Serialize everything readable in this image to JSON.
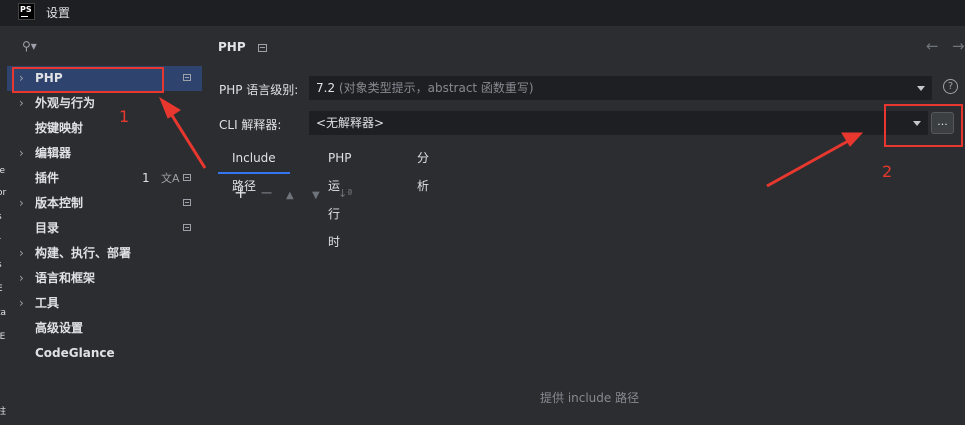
{
  "window": {
    "app_logo": "PS",
    "title": "设置"
  },
  "left_strip_letters": [
    "le",
    "or",
    "s",
    "r",
    "s",
    "E",
    "ta",
    "IE",
    "拄"
  ],
  "sidebar": {
    "search": {
      "placeholder": ""
    },
    "items": [
      {
        "label": "PHP",
        "chevron": true,
        "icon": "settings-scope-icon",
        "selected": true
      },
      {
        "label": "外观与行为",
        "chevron": true
      },
      {
        "label": "按键映射",
        "chevron": false
      },
      {
        "label": "编辑器",
        "chevron": true
      },
      {
        "label": "插件",
        "chevron": false,
        "count": "1",
        "icon": "translate-icon"
      },
      {
        "label": "版本控制",
        "chevron": true,
        "icon": "settings-scope-icon"
      },
      {
        "label": "目录",
        "chevron": false,
        "icon": "settings-scope-icon"
      },
      {
        "label": "构建、执行、部署",
        "chevron": true
      },
      {
        "label": "语言和框架",
        "chevron": true
      },
      {
        "label": "工具",
        "chevron": true
      },
      {
        "label": "高级设置",
        "chevron": false
      },
      {
        "label": "CodeGlance",
        "chevron": false
      }
    ]
  },
  "main": {
    "title": "PHP",
    "php_level": {
      "label": "PHP 语言级别:",
      "value": "7.2",
      "hint": "(对象类型提示，abstract 函数重写)"
    },
    "cli": {
      "label": "CLI 解释器:",
      "value": "<无解释器>",
      "more_label": "..."
    },
    "tabs": [
      {
        "label": "Include 路径",
        "active": true
      },
      {
        "label": "PHP 运行时",
        "active": false
      },
      {
        "label": "分析",
        "active": false
      }
    ],
    "toolbar": {
      "add": "+",
      "remove": "−",
      "up": "▲",
      "down": "▼",
      "sort": "↓ª"
    },
    "empty_text": "提供 include 路径"
  },
  "annotations": {
    "label_1": "1",
    "label_2": "2",
    "color": "#e8372e"
  },
  "colors": {
    "background": "#1e1f22",
    "panel": "#2b2d30",
    "selection": "#2e436e",
    "accent": "#3574f0"
  }
}
